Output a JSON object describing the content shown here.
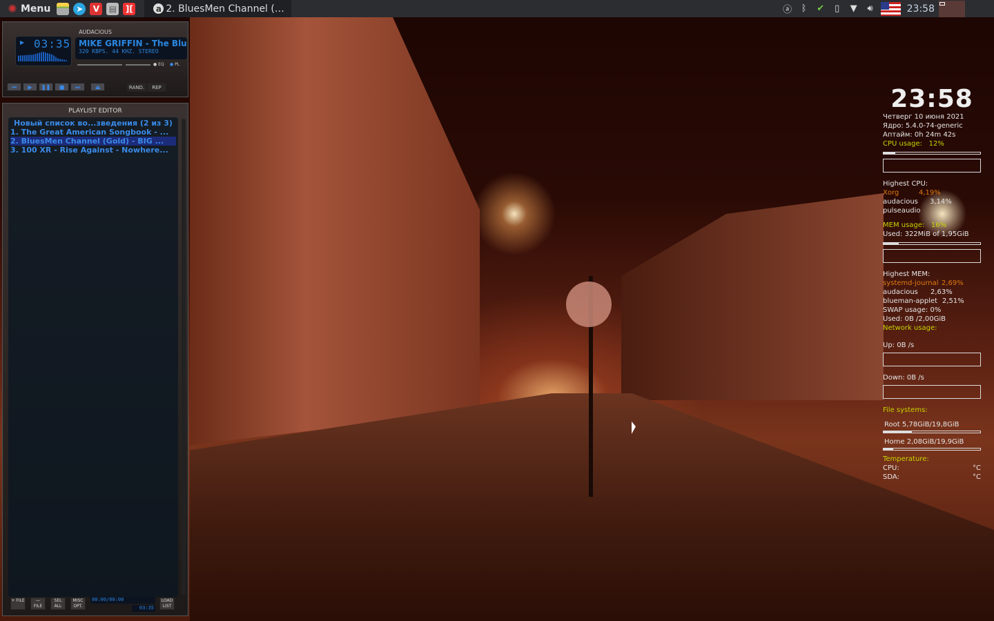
{
  "panel": {
    "menu_label": "Menu",
    "task_title": "2. BluesMen Channel (…",
    "clock": "23:58",
    "launchers": [
      "file-manager",
      "telegram",
      "vivaldi",
      "window-list",
      "app-5"
    ]
  },
  "audacious": {
    "title": "AUDACIOUS",
    "time": "03:35",
    "song": "MIKE GRIFFIN - The Blu",
    "bitrate": "320 KBPS. 44 KHZ. STEREO",
    "eq": "EQ",
    "pl": "PL",
    "rand": "RAND.",
    "rep": "REP",
    "playlist": {
      "title": "PLAYLIST EDITOR",
      "header": "Новый список во...зведения (2 из 3)",
      "items": [
        "1. The Great American Songbook - ...",
        "2. BluesMen Channel (Gold) - BIG ...",
        "3. 100 XR - Rise Against - Nowhere..."
      ],
      "selected": 1,
      "buttons": [
        "+ FILE",
        "— FILE",
        "SEL ALL",
        "MISC OPT.",
        "LOAD LIST"
      ],
      "time": "00:00/00:00",
      "length": "03:35"
    }
  },
  "conky": {
    "time": "23:58",
    "date": "Четверг 10 июня 2021",
    "kernel": "Ядро: 5.4.0-74-generic",
    "uptime": "Аптайм: 0h 24m 42s",
    "cpu_label": "CPU usage:",
    "cpu_value": "12%",
    "cpu_frac": 0.12,
    "highest_cpu_label": "Highest CPU:",
    "highest_cpu": [
      {
        "name": "Xorg",
        "val": "4,19%"
      },
      {
        "name": "audacious",
        "val": "3,14%"
      },
      {
        "name": "pulseaudio",
        "val": ""
      }
    ],
    "mem_label": "MEM usage:",
    "mem_value": "16%",
    "mem_frac": 0.16,
    "mem_used": "Used: 322MiB of 1,95GiB",
    "highest_mem_label": "Highest MEM:",
    "highest_mem": [
      {
        "name": "systemd-journal",
        "val": "2,69%"
      },
      {
        "name": "audacious",
        "val": "2,63%"
      },
      {
        "name": "blueman-applet",
        "val": "2,51%"
      }
    ],
    "swap": "SWAP usage: 0%",
    "swap_used": "Used: 0B  /2,00GiB",
    "net_label": "Network usage:",
    "up": "Up: 0B  /s",
    "down": "Down: 0B  /s",
    "fs_label": "File systems:",
    "root": "Root 5,78GiB/19,8GiB",
    "root_frac": 0.29,
    "home": "Home 2,08GiB/19,9GiB",
    "home_frac": 0.1,
    "temp_label": "Temperature:",
    "cpu_temp_label": "CPU:",
    "sda_temp_label": "SDA:",
    "unit": "°C"
  }
}
